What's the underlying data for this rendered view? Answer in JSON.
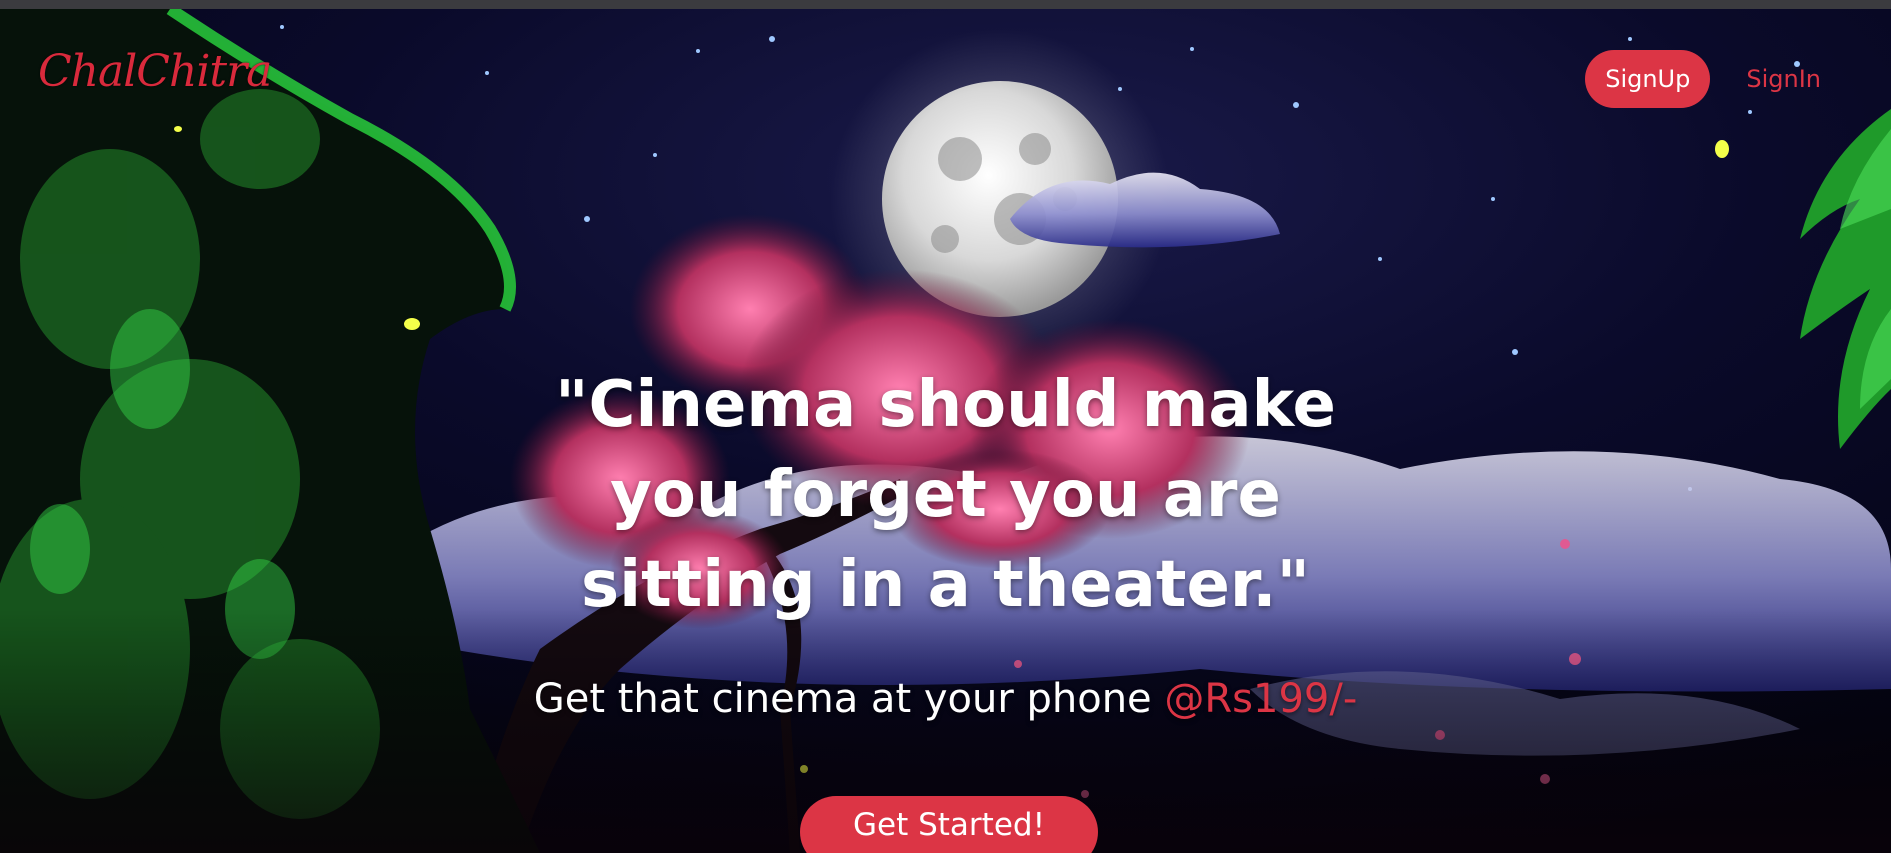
{
  "brand": {
    "logo_text": "ChalChitra",
    "accent_color": "#dc3545"
  },
  "nav": {
    "signup_label": "SignUp",
    "signin_label": "SignIn"
  },
  "hero": {
    "headline": "\"Cinema should make you forget you are sitting in a theater.\"",
    "subline_prefix": "Get that cinema at your phone ",
    "subline_price": "@Rs199/-",
    "cta_label": "Get Started!",
    "background": "night-sky-moon-blossom-tree-illustration"
  }
}
